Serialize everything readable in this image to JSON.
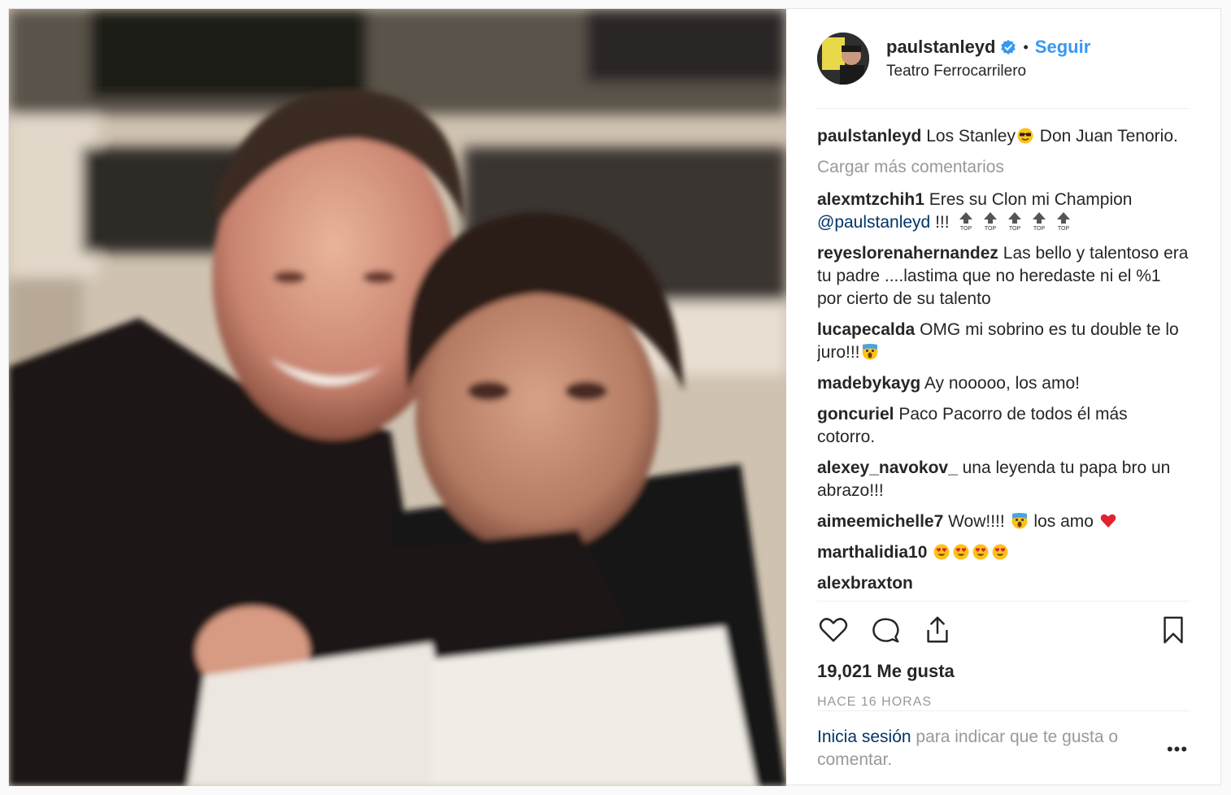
{
  "header": {
    "username": "paulstanleyd",
    "dot": "•",
    "follow_label": "Seguir",
    "location": "Teatro Ferrocarrilero"
  },
  "caption": {
    "username": "paulstanleyd",
    "text_before": " Los Stanley",
    "text_after": "  Don Juan Tenorio."
  },
  "load_more": "Cargar más comentarios",
  "comments": [
    {
      "user": "alexmtzchih1",
      "text": " Eres su Clon mi Champion "
    },
    {
      "user": "reyeslorenahernandez",
      "text": " Las bello y talentoso era tu padre ....lastima que no heredaste ni el %1 por cierto de su talento"
    },
    {
      "user": "lucapecalda",
      "text": " OMG mi sobrino es tu double te lo juro!!!"
    },
    {
      "user": "madebykayg",
      "text": " Ay nooooo, los amo!"
    },
    {
      "user": "goncuriel",
      "text": " Paco Pacorro de todos él más cotorro."
    },
    {
      "user": "alexey_navokov_",
      "text": " una leyenda tu papa bro un abrazo!!!"
    },
    {
      "user": "aimeemichelle7",
      "text": " Wow!!!! ",
      "text2": "  los amo "
    },
    {
      "user": "marthalidia10",
      "text": " "
    },
    {
      "user": "alexbraxton",
      "text": " "
    }
  ],
  "mention": "@paulstanleyd",
  "mention_suffix": " !!! ",
  "likes": "19,021 Me gusta",
  "timestamp": "HACE 16 HORAS",
  "footer": {
    "login": "Inicia sesión",
    "rest": " para indicar que te gusta o comentar.",
    "more": "•••"
  },
  "icons": [
    "verified-badge-icon",
    "heart-icon",
    "comment-icon",
    "share-icon",
    "bookmark-icon",
    "more-options-icon"
  ],
  "colors": {
    "accent": "#3897f0",
    "link": "#003569",
    "muted": "#999999",
    "text": "#262626"
  }
}
